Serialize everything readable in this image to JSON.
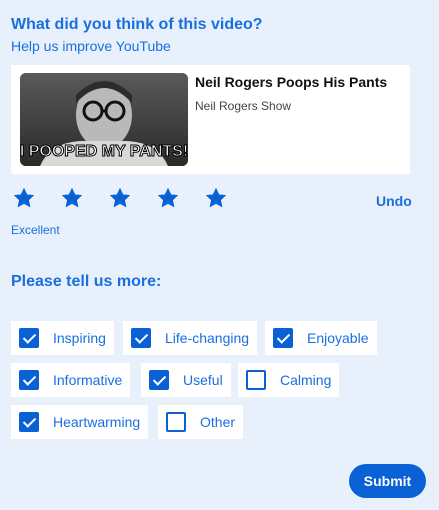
{
  "header": {
    "title": "What did you think of this video?",
    "subtitle": "Help us improve YouTube"
  },
  "video": {
    "title": "Neil Rogers Poops His Pants",
    "channel": "Neil Rogers Show",
    "thumbnail_caption": "I POOPED MY PANTS!"
  },
  "rating": {
    "max_stars": 5,
    "selected_stars": 5,
    "label": "Excellent",
    "undo_label": "Undo",
    "star_color": "#0a61d6"
  },
  "feedback": {
    "heading": "Please tell us more:",
    "options": [
      {
        "label": "Inspiring",
        "checked": true
      },
      {
        "label": "Life-changing",
        "checked": true
      },
      {
        "label": "Enjoyable",
        "checked": true
      },
      {
        "label": "Informative",
        "checked": true
      },
      {
        "label": "Useful",
        "checked": true
      },
      {
        "label": "Calming",
        "checked": false
      },
      {
        "label": "Heartwarming",
        "checked": true
      },
      {
        "label": "Other",
        "checked": false
      }
    ]
  },
  "actions": {
    "submit_label": "Submit"
  },
  "colors": {
    "accent": "#0a61d6",
    "background": "#e8f1fb"
  }
}
